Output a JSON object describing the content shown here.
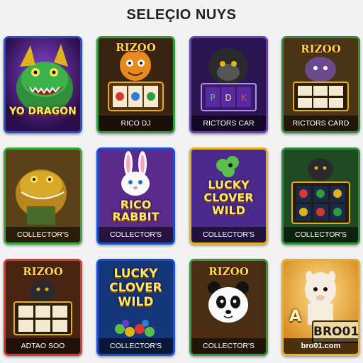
{
  "page": {
    "title": "SELEÇIO NUYS"
  },
  "tiles": [
    {
      "label": "",
      "art_text": "YO DRAGON",
      "border": "#1e4fd0"
    },
    {
      "label": "RICO DJ",
      "logo": "RIZOO",
      "border": "#2e9d3a"
    },
    {
      "label": "RICTORS CAR",
      "border": "#6a3bc8"
    },
    {
      "label": "RICTORS CARD",
      "logo": "RIZOO",
      "border": "#2e8f3a"
    },
    {
      "label": "COLLECTOR'S CARD",
      "border": "#37a83e"
    },
    {
      "label": "COLLECTOR'S CARD",
      "art_text_1": "RICO",
      "art_text_2": "RABBIT",
      "border": "#1e4fd0"
    },
    {
      "label": "COLLECTOR'S CARD",
      "art_text_1": "LUCKY",
      "art_text_2": "CLOVER",
      "art_text_3": "WILD",
      "border": "#e2b21c"
    },
    {
      "label": "COLLECTOR'S CARD",
      "border": "#2e8f3a"
    },
    {
      "label": "ADTAO SOO",
      "logo": "RIZOO",
      "border": "#d8392b"
    },
    {
      "label": "COLLECTOR'S CARD",
      "art_text_1": "LUCKY",
      "art_text_2": "CLOVER",
      "art_text_3": "WILD",
      "border": "#1e4fd0"
    },
    {
      "label": "COLLECTOR'S CARD",
      "logo": "RIZOO",
      "border": "#2e9d3a"
    },
    {
      "label": "bro01.com",
      "badge": "BRO01",
      "partial_text": "A",
      "border": "#e6b030"
    }
  ]
}
